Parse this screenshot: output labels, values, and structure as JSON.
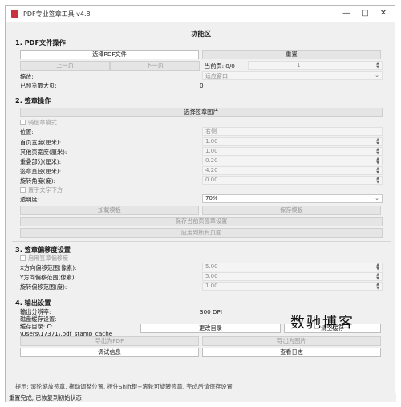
{
  "window": {
    "title": "PDF专业签章工具 v4.8",
    "panel_title": "功能区"
  },
  "section1": {
    "title": "1. PDF文件操作",
    "select_pdf": "选择PDF文件",
    "reset": "重置",
    "prev_page": "上一页",
    "next_page": "下一页",
    "current_page_label": "当前页: 0/0",
    "page_spin_value": "1",
    "zoom_label": "缩放:",
    "zoom_value": "适应窗口",
    "max_preview_label": "已预览最大页:",
    "max_preview_value": "0"
  },
  "section2": {
    "title": "2. 签章操作",
    "select_image": "选择签章图片",
    "riding_seal": "骑缝章模式",
    "position_label": "位置:",
    "position_value": "右侧",
    "first_width_label": "首页宽度(厘米):",
    "first_width_value": "1.00",
    "other_width_label": "其他页宽度(厘米):",
    "other_width_value": "1.00",
    "overlap_label": "重叠部分(厘米):",
    "overlap_value": "0.20",
    "diameter_label": "签章直径(厘米):",
    "diameter_value": "4.20",
    "rotation_label": "旋转角度(度):",
    "rotation_value": "0.00",
    "below_text": "置于文字下方",
    "opacity_label": "透明度:",
    "opacity_value": "70%",
    "load_template": "加载模板",
    "save_template": "保存模板",
    "save_current_settings": "保存当前页签章设置",
    "apply_all_pages": "应用到所有页面"
  },
  "section3": {
    "title": "3. 签章偏移度设置",
    "enable_offset": "启用签章偏移度",
    "x_range_label": "X方向偏移范围(像素):",
    "x_range_value": "5.00",
    "y_range_label": "Y方向偏移范围(像素):",
    "y_range_value": "5.00",
    "rot_range_label": "旋转偏移范围(度):",
    "rot_range_value": "1.00"
  },
  "section4": {
    "title": "4. 输出设置",
    "dpi_label": "输出分辨率:",
    "dpi_value": "300 DPI",
    "cache_label": "磁盘缓存设置:",
    "cache_dir_label": "缓存目录: C:",
    "cache_dir_path": "\\Users\\17371\\.pdf_stamp_cache",
    "change_dir": "更改目录",
    "clear_cache": "清空缓存",
    "export_pdf": "导出为PDF",
    "export_image": "导出为图片",
    "debug_info": "调试信息",
    "view_log": "查看日志"
  },
  "watermark": "数驰博客",
  "hint": "提示: 滚轮缩放签章, 拖动调整位置, 按住Shift键+滚轮可旋转签章, 完成后请保存设置",
  "status": "重置完成, 已恢复到初始状态"
}
